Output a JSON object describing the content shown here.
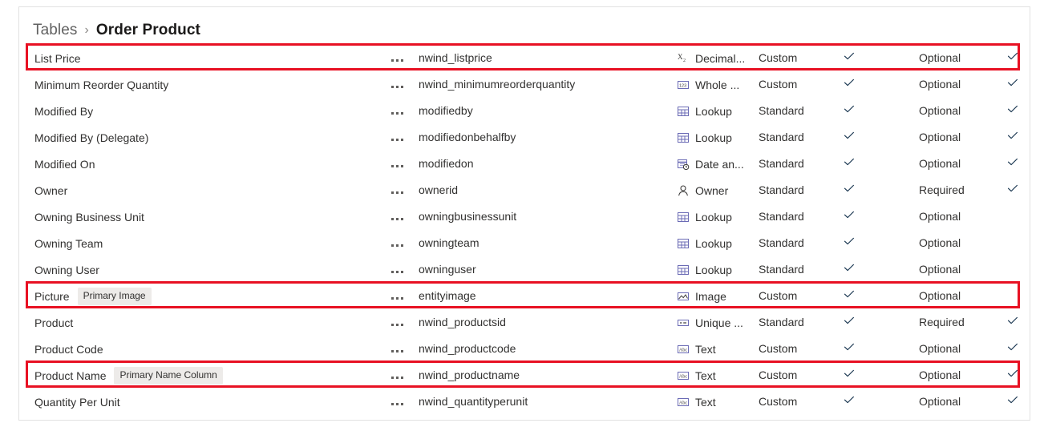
{
  "breadcrumb": {
    "parent": "Tables",
    "separator": "›",
    "current": "Order Product"
  },
  "colors": {
    "highlight": "#e81123",
    "text": "#323130",
    "muted": "#616161",
    "badge_bg": "#edebe9",
    "border": "#e1e1e1",
    "check": "#0b3b60"
  },
  "menu_glyph": "...",
  "rows": [
    {
      "display_name": "List Price",
      "badge": "",
      "logical_name": "nwind_listprice",
      "type_icon": "decimal-icon",
      "type": "Decimal...",
      "custom": "Custom",
      "customizable": true,
      "required": "Optional",
      "required_check": true,
      "highlighted": true
    },
    {
      "display_name": "Minimum Reorder Quantity",
      "badge": "",
      "logical_name": "nwind_minimumreorderquantity",
      "type_icon": "whole-number-icon",
      "type": "Whole ...",
      "custom": "Custom",
      "customizable": true,
      "required": "Optional",
      "required_check": true,
      "highlighted": false
    },
    {
      "display_name": "Modified By",
      "badge": "",
      "logical_name": "modifiedby",
      "type_icon": "lookup-icon",
      "type": "Lookup",
      "custom": "Standard",
      "customizable": true,
      "required": "Optional",
      "required_check": true,
      "highlighted": false
    },
    {
      "display_name": "Modified By (Delegate)",
      "badge": "",
      "logical_name": "modifiedonbehalfby",
      "type_icon": "lookup-icon",
      "type": "Lookup",
      "custom": "Standard",
      "customizable": true,
      "required": "Optional",
      "required_check": true,
      "highlighted": false
    },
    {
      "display_name": "Modified On",
      "badge": "",
      "logical_name": "modifiedon",
      "type_icon": "date-time-icon",
      "type": "Date an...",
      "custom": "Standard",
      "customizable": true,
      "required": "Optional",
      "required_check": true,
      "highlighted": false
    },
    {
      "display_name": "Owner",
      "badge": "",
      "logical_name": "ownerid",
      "type_icon": "owner-icon",
      "type": "Owner",
      "custom": "Standard",
      "customizable": true,
      "required": "Required",
      "required_check": true,
      "highlighted": false
    },
    {
      "display_name": "Owning Business Unit",
      "badge": "",
      "logical_name": "owningbusinessunit",
      "type_icon": "lookup-icon",
      "type": "Lookup",
      "custom": "Standard",
      "customizable": true,
      "required": "Optional",
      "required_check": false,
      "highlighted": false
    },
    {
      "display_name": "Owning Team",
      "badge": "",
      "logical_name": "owningteam",
      "type_icon": "lookup-icon",
      "type": "Lookup",
      "custom": "Standard",
      "customizable": true,
      "required": "Optional",
      "required_check": false,
      "highlighted": false
    },
    {
      "display_name": "Owning User",
      "badge": "",
      "logical_name": "owninguser",
      "type_icon": "lookup-icon",
      "type": "Lookup",
      "custom": "Standard",
      "customizable": true,
      "required": "Optional",
      "required_check": false,
      "highlighted": false
    },
    {
      "display_name": "Picture",
      "badge": "Primary Image",
      "logical_name": "entityimage",
      "type_icon": "image-icon",
      "type": "Image",
      "custom": "Custom",
      "customizable": true,
      "required": "Optional",
      "required_check": false,
      "highlighted": true
    },
    {
      "display_name": "Product",
      "badge": "",
      "logical_name": "nwind_productsid",
      "type_icon": "unique-id-icon",
      "type": "Unique ...",
      "custom": "Standard",
      "customizable": true,
      "required": "Required",
      "required_check": true,
      "highlighted": false
    },
    {
      "display_name": "Product Code",
      "badge": "",
      "logical_name": "nwind_productcode",
      "type_icon": "text-icon",
      "type": "Text",
      "custom": "Custom",
      "customizable": true,
      "required": "Optional",
      "required_check": true,
      "highlighted": false
    },
    {
      "display_name": "Product Name",
      "badge": "Primary Name Column",
      "logical_name": "nwind_productname",
      "type_icon": "text-icon",
      "type": "Text",
      "custom": "Custom",
      "customizable": true,
      "required": "Optional",
      "required_check": true,
      "highlighted": true
    },
    {
      "display_name": "Quantity Per Unit",
      "badge": "",
      "logical_name": "nwind_quantityperunit",
      "type_icon": "text-icon",
      "type": "Text",
      "custom": "Custom",
      "customizable": true,
      "required": "Optional",
      "required_check": true,
      "highlighted": false
    }
  ]
}
